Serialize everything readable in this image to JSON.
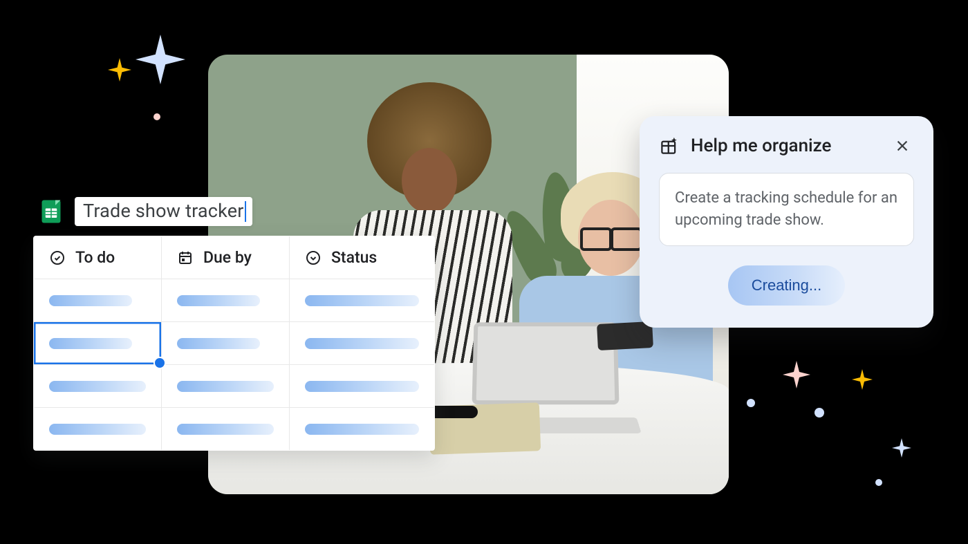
{
  "sheet": {
    "doc_title": "Trade show tracker",
    "columns": [
      {
        "icon": "check-circle",
        "label": "To do"
      },
      {
        "icon": "calendar",
        "label": "Due by"
      },
      {
        "icon": "chevron-down-circle",
        "label": "Status"
      }
    ],
    "selected_cell": {
      "row": 1,
      "col": 0
    }
  },
  "help_panel": {
    "title": "Help me organize",
    "prompt": "Create a tracking schedule for an upcoming trade show.",
    "button_label": "Creating..."
  }
}
